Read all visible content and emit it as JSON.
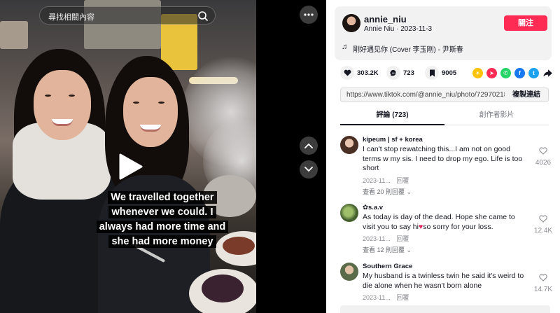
{
  "search": {
    "placeholder": "尋找相關內容"
  },
  "post": {
    "caption_lines": [
      "We travelled together",
      "whenever we could. I",
      "always had more time and",
      "she had more money"
    ]
  },
  "author": {
    "username": "annie_niu",
    "display_name": "Annie Niu",
    "date": "2023-11-3",
    "follow_label": "關注"
  },
  "music": {
    "title": "剛好遇见你 (Cover 李玉刚) - 尹斯春"
  },
  "stats": {
    "likes": "303.2K",
    "comments": "723",
    "saves": "9005"
  },
  "share": {
    "colors": {
      "sun": "#fec200",
      "send": "#fe2c55",
      "whatsapp": "#25d366",
      "facebook": "#1877f2",
      "twitter": "#1da1f2"
    },
    "url": "https://www.tiktok.com/@annie_niu/photo/7297021842...",
    "copy_label": "複製連結"
  },
  "tabs": {
    "comments": "評論 (723)",
    "creator": "創作者影片"
  },
  "comments": [
    {
      "user": "kipeum | sf + korea",
      "text": "I can't stop rewatching this...I am not on good terms w my sis. I need to drop my ego. Life is too short",
      "date": "2023-11...",
      "reply": "回覆",
      "more": "查看 20 則回覆",
      "likes": "4026"
    },
    {
      "user": "✿s.a.v",
      "text_before": "As today is day of the dead. Hope she came to visit you to say hi",
      "text_after": "so sorry for your loss.",
      "date": "2023-11...",
      "reply": "回覆",
      "more": "查看 12 則回覆",
      "likes": "12.4K"
    },
    {
      "user": "Southern Grace",
      "text": "My husband is a twinless twin he said it's weird to die alone when he wasn't born alone",
      "date": "2023-11...",
      "reply": "回覆",
      "likes": "14.7K"
    }
  ]
}
